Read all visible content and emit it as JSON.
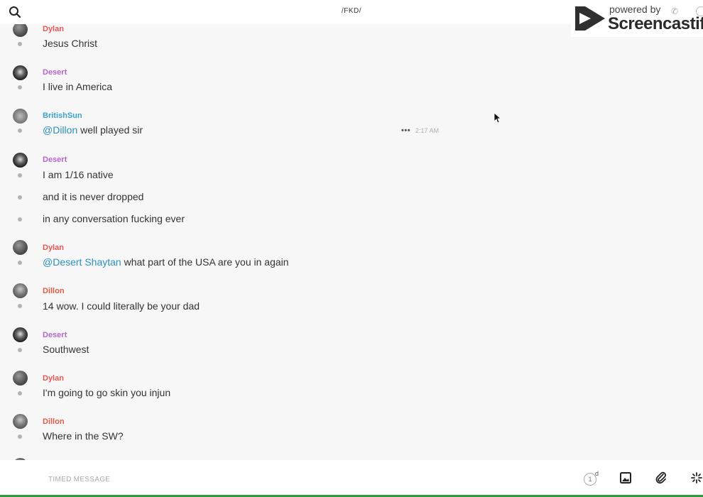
{
  "header": {
    "title": "/FKD/",
    "search_icon": "search-icon"
  },
  "watermark": {
    "powered": "powered by",
    "brand": "Screencastify"
  },
  "colors": {
    "dylan": "#e5574f",
    "desert": "#b566cf",
    "britishsun": "#3aa3c9",
    "dillon": "#e05c46",
    "mention": "#2b8fbd"
  },
  "messages": [
    {
      "author": "Dylan",
      "lines": [
        {
          "text": "Jesus Christ"
        }
      ]
    },
    {
      "author": "Desert",
      "lines": [
        {
          "text": "I live in America"
        }
      ]
    },
    {
      "author": "BritishSun",
      "lines": [
        {
          "mention": "@Dillon",
          "text": " well played sir"
        }
      ],
      "more": "•••",
      "timestamp": "2:17 AM"
    },
    {
      "author": "Desert",
      "lines": [
        {
          "text": "I am 1/16 native"
        },
        {
          "text": "and it is never dropped"
        },
        {
          "text": "in any conversation fucking ever"
        }
      ]
    },
    {
      "author": "Dylan",
      "lines": [
        {
          "mention": "@Desert Shaytan",
          "text": " what part of the USA are you in again"
        }
      ]
    },
    {
      "author": "Dillon",
      "lines": [
        {
          "text": "14 wow. I could literally be your dad"
        }
      ]
    },
    {
      "author": "Desert",
      "lines": [
        {
          "text": "Southwest"
        }
      ]
    },
    {
      "author": "Dylan",
      "lines": [
        {
          "text": "I'm going to go skin you injun"
        }
      ]
    },
    {
      "author": "Dillon",
      "lines": [
        {
          "text": "Where in the SW?"
        }
      ]
    }
  ],
  "composer": {
    "placeholder": "TIMED MESSAGE",
    "timer_value": "1",
    "timer_unit": "d",
    "icons": [
      "image-icon",
      "paperclip-icon",
      "sparkle-icon"
    ]
  }
}
